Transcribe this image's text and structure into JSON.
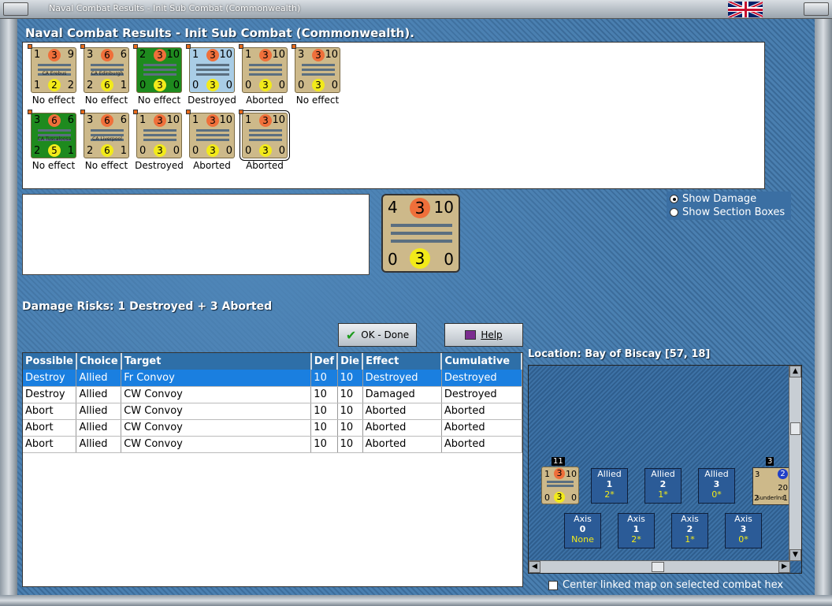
{
  "window": {
    "title": "Naval Combat Results - Init Sub Combat (Commonwealth)"
  },
  "heading": "Naval Combat Results - Init Sub Combat (Commonwealth).",
  "units": [
    {
      "tl": "1",
      "tc": "3",
      "tr": "9",
      "bl": "1",
      "bc": "2",
      "br": "2",
      "name": "CA Erebus",
      "result": "No effect",
      "style": "tan"
    },
    {
      "tl": "3",
      "tc": "6",
      "tr": "6",
      "bl": "2",
      "bc": "6",
      "br": "1",
      "name": "CA Edinburgh",
      "result": "No effect",
      "style": "tan"
    },
    {
      "tl": "2",
      "tc": "3",
      "tr": "10",
      "bl": "0",
      "bc": "3",
      "br": "0",
      "name": "",
      "result": "No effect",
      "style": "green"
    },
    {
      "tl": "1",
      "tc": "3",
      "tr": "10",
      "bl": "0",
      "bc": "3",
      "br": "0",
      "name": "",
      "result": "Destroyed",
      "style": "blue"
    },
    {
      "tl": "1",
      "tc": "3",
      "tr": "10",
      "bl": "0",
      "bc": "3",
      "br": "0",
      "name": "",
      "result": "Aborted",
      "style": "tan"
    },
    {
      "tl": "3",
      "tc": "3",
      "tr": "10",
      "bl": "0",
      "bc": "3",
      "br": "0",
      "name": "",
      "result": "No effect",
      "style": "tan"
    },
    {
      "tl": "3",
      "tc": "6",
      "tr": "6",
      "bl": "2",
      "bc": "5",
      "br": "1",
      "name": "CA Tuscaloosa",
      "result": "No effect",
      "style": "green"
    },
    {
      "tl": "3",
      "tc": "6",
      "tr": "6",
      "bl": "2",
      "bc": "6",
      "br": "1",
      "name": "CA Liverpool",
      "result": "No effect",
      "style": "tan"
    },
    {
      "tl": "1",
      "tc": "3",
      "tr": "10",
      "bl": "0",
      "bc": "3",
      "br": "0",
      "name": "",
      "result": "Destroyed",
      "style": "tan"
    },
    {
      "tl": "1",
      "tc": "3",
      "tr": "10",
      "bl": "0",
      "bc": "3",
      "br": "0",
      "name": "",
      "result": "Aborted",
      "style": "tan"
    },
    {
      "tl": "1",
      "tc": "3",
      "tr": "10",
      "bl": "0",
      "bc": "3",
      "br": "0",
      "name": "",
      "result": "Aborted",
      "style": "tan"
    }
  ],
  "big_counter": {
    "tl": "4",
    "tc": "3",
    "tr": "10",
    "bl": "0",
    "bc": "3",
    "br": "0"
  },
  "radios": {
    "show_damage": "Show Damage",
    "show_sections": "Show Section Boxes"
  },
  "damage_risks": "Damage Risks:  1 Destroyed + 3 Aborted",
  "buttons": {
    "ok": "OK - Done",
    "help": "Help"
  },
  "table": {
    "headers": [
      "Possible",
      "Choice",
      "Target",
      "Def",
      "Die",
      "Effect",
      "Cumulative"
    ],
    "rows": [
      [
        "Destroy",
        "Allied",
        "Fr Convoy",
        "10",
        "10",
        "Destroyed",
        "Destroyed"
      ],
      [
        "Destroy",
        "Allied",
        "CW Convoy",
        "10",
        "10",
        "Damaged",
        "Destroyed"
      ],
      [
        "Abort",
        "Allied",
        "CW Convoy",
        "10",
        "10",
        "Aborted",
        "Aborted"
      ],
      [
        "Abort",
        "Allied",
        "CW Convoy",
        "10",
        "10",
        "Aborted",
        "Aborted"
      ],
      [
        "Abort",
        "Allied",
        "CW Convoy",
        "10",
        "10",
        "Aborted",
        "Aborted"
      ]
    ]
  },
  "location": "Location:  Bay of Biscay [57, 18]",
  "map": {
    "allied_boxes": [
      {
        "label": "Allied",
        "num": "1",
        "val": "2*"
      },
      {
        "label": "Allied",
        "num": "2",
        "val": "1*"
      },
      {
        "label": "Allied",
        "num": "3",
        "val": "0*"
      }
    ],
    "axis_boxes": [
      {
        "label": "Axis",
        "num": "0",
        "val": "None"
      },
      {
        "label": "Axis",
        "num": "1",
        "val": "2*"
      },
      {
        "label": "Axis",
        "num": "2",
        "val": "1*"
      },
      {
        "label": "Axis",
        "num": "3",
        "val": "0*"
      }
    ],
    "stack_count": "11",
    "unit_counter": {
      "tl": "1",
      "tc": "3",
      "tr": "10",
      "bl": "0",
      "bc": "3",
      "br": "0"
    },
    "right_unit": {
      "tl": "3",
      "badge": "2",
      "val": "20",
      "name": "Sunderlnd",
      "bl": "2",
      "br": "1",
      "count": "3"
    }
  },
  "center_link": "Center linked map on selected combat hex"
}
